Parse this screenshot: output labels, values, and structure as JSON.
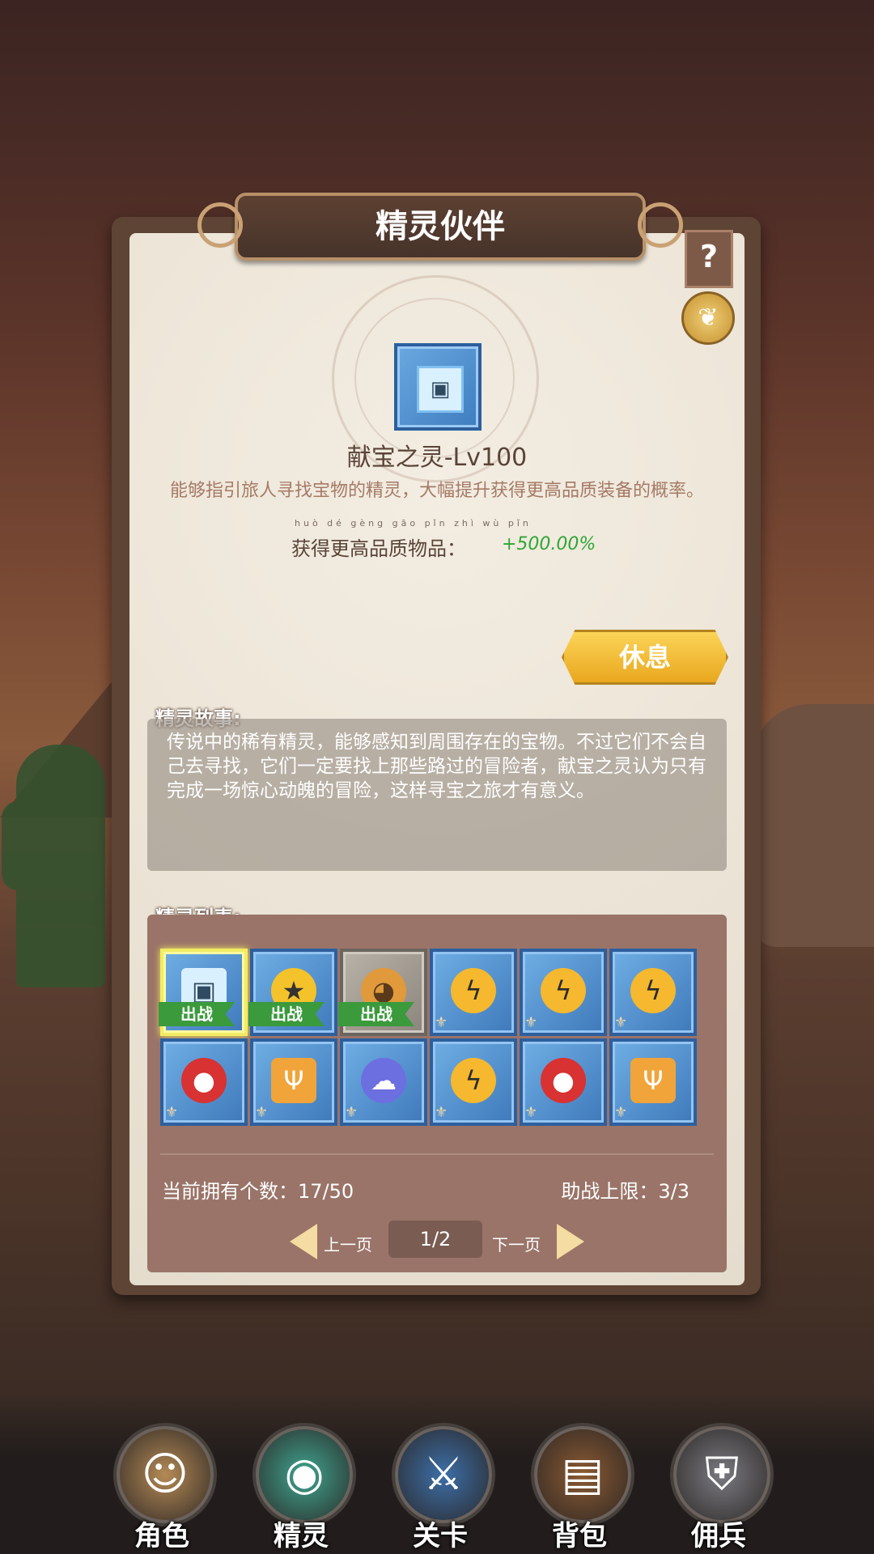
{
  "title": "精灵伙伴",
  "help_label": "?",
  "wing_icon_glyph": "❦",
  "current_spirit": {
    "name": "献宝之灵-Lv100",
    "description": "能够指引旅人寻找宝物的精灵，大幅提升获得更高品质装备的概率。",
    "stat_label": "获得更高品质物品：",
    "stat_pinyin": "huò dé gèng gāo pǐn zhì wù pǐn",
    "stat_value": "+500.00%",
    "value_color": "#2ea636"
  },
  "rest_button": "休息",
  "story": {
    "label": "精灵故事:",
    "text": "传说中的稀有精灵，能够感知到周围存在的宝物。不过它们不会自己去寻找，它们一定要找上那些路过的冒险者，献宝之灵认为只有完成一场惊心动魄的冒险，这样寻宝之旅才有意义。"
  },
  "list": {
    "label": "精灵列表:",
    "deploy_tag": "出战",
    "items": [
      {
        "icon": "cube-spirit-icon",
        "glyph": "▣",
        "deployed": true,
        "selected": true
      },
      {
        "icon": "star-spirit-icon",
        "glyph": "★",
        "deployed": true
      },
      {
        "icon": "golem-spirit-icon",
        "glyph": "◕",
        "deployed": true,
        "gray": true
      },
      {
        "icon": "flame-spirit-icon",
        "glyph": "ϟ"
      },
      {
        "icon": "flame-spirit-icon",
        "glyph": "ϟ"
      },
      {
        "icon": "flame-spirit-icon",
        "glyph": "ϟ"
      },
      {
        "icon": "red-blob-icon",
        "glyph": "●"
      },
      {
        "icon": "trident-icon",
        "glyph": "Ψ"
      },
      {
        "icon": "ghost-spirit-icon",
        "glyph": "☁"
      },
      {
        "icon": "flame-spirit-icon",
        "glyph": "ϟ"
      },
      {
        "icon": "red-blob-icon",
        "glyph": "●"
      },
      {
        "icon": "trident-icon",
        "glyph": "Ψ"
      }
    ],
    "owned_count": "当前拥有个数：17/50",
    "assist_limit": "助战上限：3/3",
    "prev_page": "上一页",
    "next_page": "下一页",
    "page": "1/2"
  },
  "bottom_nav": [
    {
      "label": "角色",
      "icon": "character-icon",
      "glyph": "☺",
      "color": "#b48a55"
    },
    {
      "label": "精灵",
      "icon": "spirit-icon",
      "glyph": "◉",
      "color": "#3fa58f"
    },
    {
      "label": "关卡",
      "icon": "stage-icon",
      "glyph": "⚔",
      "color": "#3c6fa8"
    },
    {
      "label": "背包",
      "icon": "backpack-icon",
      "glyph": "▤",
      "color": "#8a5a32"
    },
    {
      "label": "佣兵",
      "icon": "mercenary-icon",
      "glyph": "⛨",
      "color": "#7a7a80"
    }
  ]
}
